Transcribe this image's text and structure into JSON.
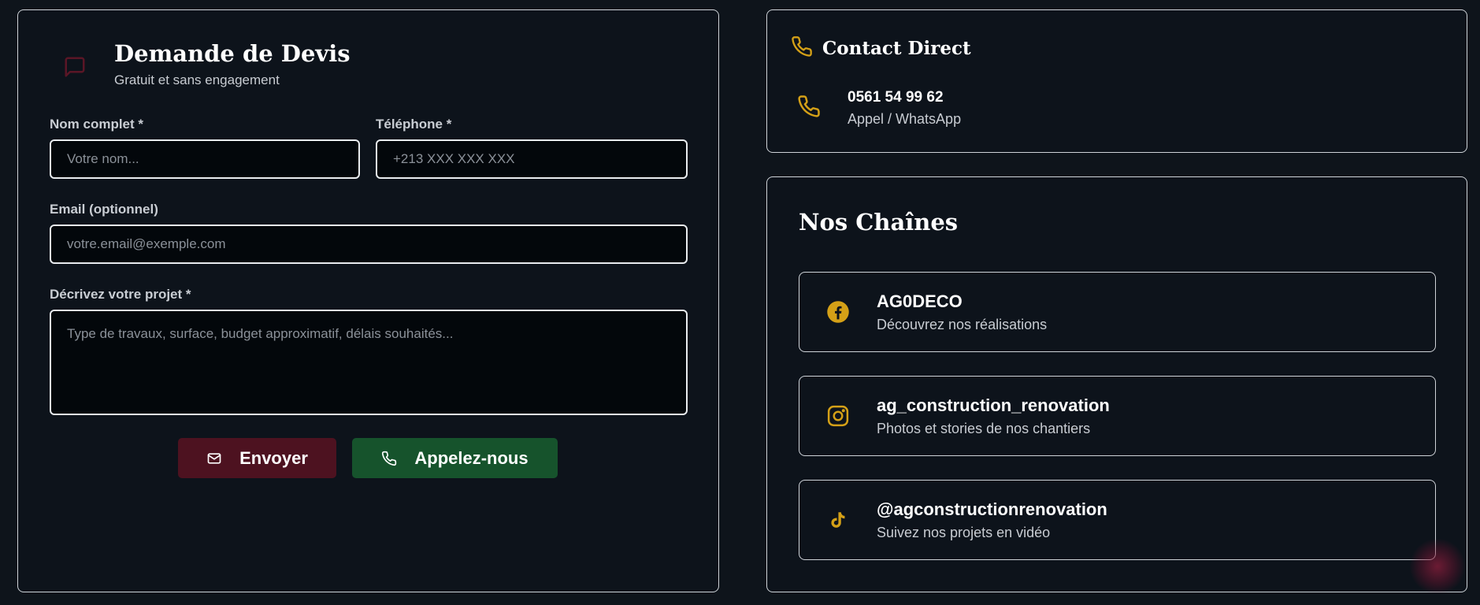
{
  "quote_form": {
    "title": "Demande de Devis",
    "subtitle": "Gratuit et sans engagement",
    "fields": {
      "name": {
        "label": "Nom complet *",
        "placeholder": "Votre nom...",
        "value": ""
      },
      "phone": {
        "label": "Téléphone *",
        "placeholder": "+213 XXX XXX XXX",
        "value": ""
      },
      "email": {
        "label": "Email (optionnel)",
        "placeholder": "votre.email@exemple.com",
        "value": ""
      },
      "project": {
        "label": "Décrivez votre projet *",
        "placeholder": "Type de travaux, surface, budget approximatif, délais souhaités...",
        "value": ""
      }
    },
    "buttons": {
      "send": "Envoyer",
      "call": "Appelez-nous"
    }
  },
  "contact": {
    "title": "Contact Direct",
    "phone": "0561 54 99 62",
    "phone_sub": "Appel / WhatsApp"
  },
  "channels": {
    "title": "Nos Chaînes",
    "items": [
      {
        "icon": "facebook-icon",
        "name": "AG0DECO",
        "desc": "Découvrez nos réalisations"
      },
      {
        "icon": "instagram-icon",
        "name": "ag_construction_renovation",
        "desc": "Photos et stories de nos chantiers"
      },
      {
        "icon": "tiktok-icon",
        "name": "@agconstructionrenovation",
        "desc": "Suivez nos projets en vidéo"
      }
    ]
  },
  "colors": {
    "background": "#0e141b",
    "accent_gold": "#d4a017",
    "send_button": "#4d1220",
    "call_button": "#16532c",
    "maroon_icon": "#5a1626"
  }
}
